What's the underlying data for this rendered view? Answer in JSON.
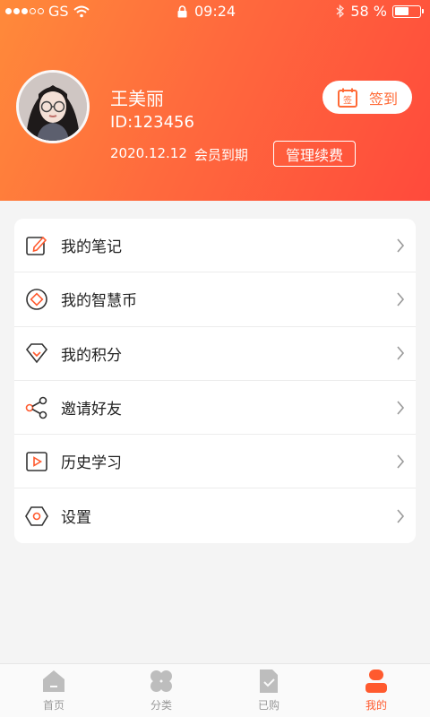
{
  "status_bar": {
    "carrier": "GS",
    "time": "09:24",
    "battery_percent": "58 %",
    "battery_level": 0.58
  },
  "profile": {
    "name": "王美丽",
    "id": "ID:123456",
    "expiry_date": "2020.12.12",
    "expiry_text": "会员到期",
    "renew_label": "管理续费",
    "signin_label": "签到",
    "signin_icon_char": "签"
  },
  "menu": {
    "items": [
      {
        "label": "我的笔记",
        "icon": "note-edit-icon"
      },
      {
        "label": "我的智慧币",
        "icon": "coin-icon"
      },
      {
        "label": "我的积分",
        "icon": "diamond-icon"
      },
      {
        "label": "邀请好友",
        "icon": "share-icon"
      },
      {
        "label": "历史学习",
        "icon": "play-history-icon"
      },
      {
        "label": "设置",
        "icon": "settings-hexagon-icon"
      }
    ]
  },
  "tabbar": {
    "items": [
      {
        "label": "首页",
        "icon": "home-icon",
        "active": false
      },
      {
        "label": "分类",
        "icon": "category-icon",
        "active": false
      },
      {
        "label": "已购",
        "icon": "purchased-icon",
        "active": false
      },
      {
        "label": "我的",
        "icon": "profile-icon",
        "active": true
      }
    ]
  },
  "colors": {
    "accent": "#ff5a2e",
    "header_gradient_start": "#ff8a3a",
    "header_gradient_end": "#ff4a3c",
    "inactive_tab": "#999999"
  }
}
